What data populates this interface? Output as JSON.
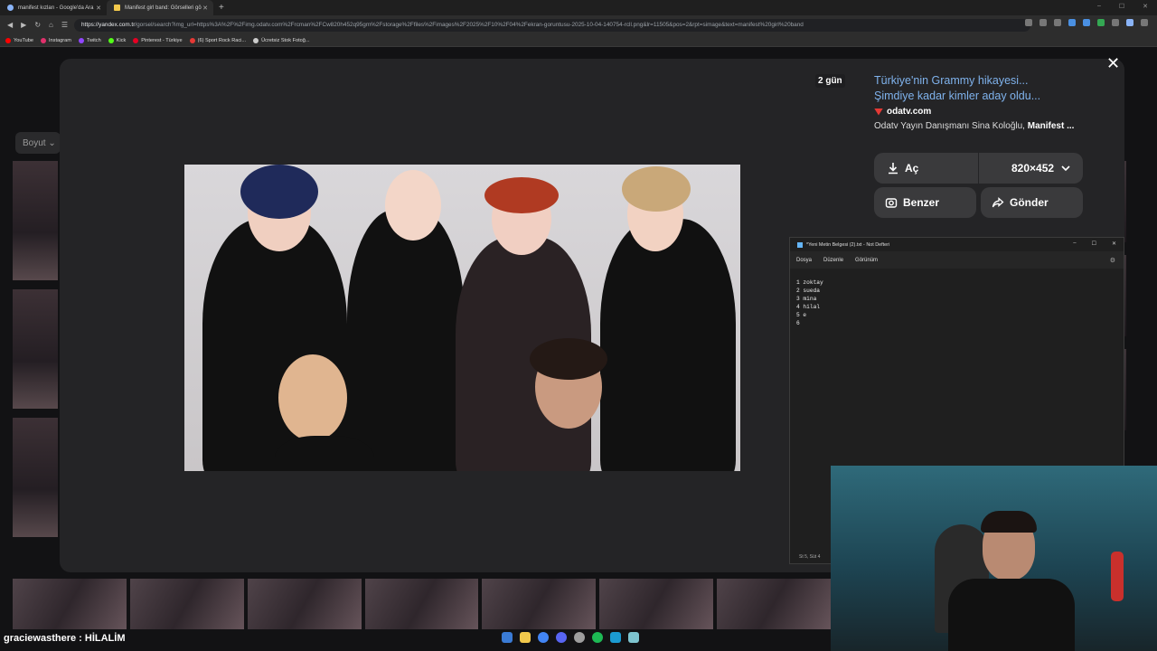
{
  "browser": {
    "tabs": [
      {
        "title": "manifest kızları - Google'da Ara"
      },
      {
        "title": "Manifest girl band: Görselleri gö"
      }
    ],
    "url_host": "https://yandex.com.tr",
    "url_path": "/gorsel/search?img_url=https%3A%2F%2Fimg.odatv.com%2Frcman%2FCw820h452q95gm%2Fstorage%2Ffiles%2Fimages%2F2025%2F10%2F04%2Fekran-goruntusu-2025-10-04-140754-rcll.png&lr=11505&pos=2&rpt=simage&text=manifest%20girl%20band",
    "bookmarks": [
      "YouTube",
      "Instagram",
      "Twitch",
      "Kick",
      "Pinterest - Türkiye",
      "(6) Sport Rock Raci...",
      "Ücretsiz Stok Fotoğ..."
    ],
    "bookmark_colors": [
      "#ff0000",
      "#e1306c",
      "#9146ff",
      "#53fc18",
      "#e60023",
      "#e53935",
      "#cccccc"
    ]
  },
  "page": {
    "filter_label": "Boyut",
    "age_badge": "2 gün"
  },
  "panel": {
    "title": "Türkiye'nin Grammy hikayesi... Şimdiye kadar kimler aday oldu...",
    "source": "odatv.com",
    "desc_prefix": "Odatv Yayın Danışmanı Sina Koloğlu, ",
    "desc_bold": "Manifest ...",
    "open_label": "Aç",
    "size_label": "820×452",
    "similar_label": "Benzer",
    "share_label": "Gönder"
  },
  "notepad": {
    "title": "*Yeni Metin Belgesi (2).txt - Not Defteri",
    "menu": [
      "Dosya",
      "Düzenle",
      "Görünüm"
    ],
    "lines": [
      "1 zoktay",
      "2 sueda",
      "3 mina",
      "4 hilal",
      "5 e",
      "6"
    ],
    "status": "St 5, Süt 4"
  },
  "chat": {
    "user": "graciewasthere",
    "message": "HİLALİM"
  },
  "taskbar_colors": [
    "#3a7bd5",
    "#f2c94c",
    "#4285f4",
    "#5865f2",
    "#9e9e9e",
    "#1db954",
    "#1b9bd1",
    "#7ec4cf"
  ]
}
